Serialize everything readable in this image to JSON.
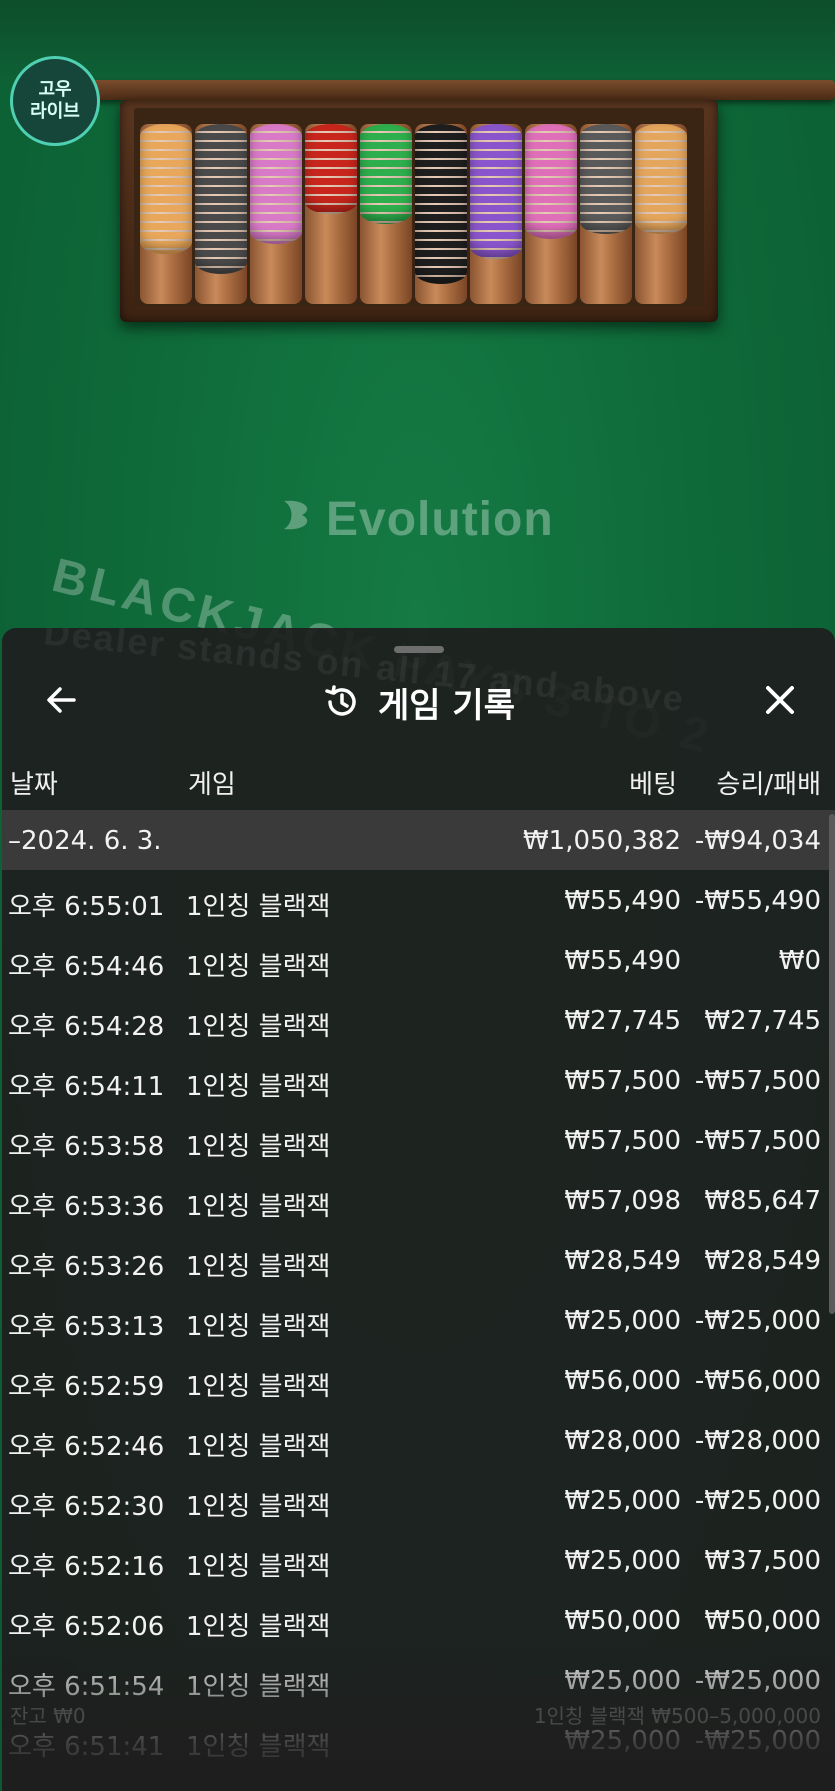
{
  "brand_logo": {
    "line1": "고우",
    "line2": "라이브"
  },
  "table": {
    "provider": "Evolution",
    "arc_text": "BLACKJACK PAYS 3 TO 2",
    "sub_text": "Dealer stands on all 17 and above",
    "chip_colors": [
      "#e8a75a",
      "#4a4a4a",
      "#d97ac8",
      "#c8261c",
      "#2eae4c",
      "#1e1e1e",
      "#8a55cc",
      "#df6fb9",
      "#5a5a5a",
      "#e4a55c"
    ]
  },
  "sheet": {
    "title": "게임 기록",
    "columns": {
      "date": "날짜",
      "game": "게임",
      "bet": "베팅",
      "result": "승리/패배"
    },
    "date_row": {
      "date": "–2024. 6. 3.",
      "bet": "₩1,050,382",
      "result": "-₩94,034"
    },
    "rows": [
      {
        "time": "오후 6:55:01",
        "game": "1인칭 블랙잭",
        "bet": "₩55,490",
        "result": "-₩55,490"
      },
      {
        "time": "오후 6:54:46",
        "game": "1인칭 블랙잭",
        "bet": "₩55,490",
        "result": "₩0"
      },
      {
        "time": "오후 6:54:28",
        "game": "1인칭 블랙잭",
        "bet": "₩27,745",
        "result": "₩27,745"
      },
      {
        "time": "오후 6:54:11",
        "game": "1인칭 블랙잭",
        "bet": "₩57,500",
        "result": "-₩57,500"
      },
      {
        "time": "오후 6:53:58",
        "game": "1인칭 블랙잭",
        "bet": "₩57,500",
        "result": "-₩57,500"
      },
      {
        "time": "오후 6:53:36",
        "game": "1인칭 블랙잭",
        "bet": "₩57,098",
        "result": "₩85,647"
      },
      {
        "time": "오후 6:53:26",
        "game": "1인칭 블랙잭",
        "bet": "₩28,549",
        "result": "₩28,549"
      },
      {
        "time": "오후 6:53:13",
        "game": "1인칭 블랙잭",
        "bet": "₩25,000",
        "result": "-₩25,000"
      },
      {
        "time": "오후 6:52:59",
        "game": "1인칭 블랙잭",
        "bet": "₩56,000",
        "result": "-₩56,000"
      },
      {
        "time": "오후 6:52:46",
        "game": "1인칭 블랙잭",
        "bet": "₩28,000",
        "result": "-₩28,000"
      },
      {
        "time": "오후 6:52:30",
        "game": "1인칭 블랙잭",
        "bet": "₩25,000",
        "result": "-₩25,000"
      },
      {
        "time": "오후 6:52:16",
        "game": "1인칭 블랙잭",
        "bet": "₩25,000",
        "result": "₩37,500"
      },
      {
        "time": "오후 6:52:06",
        "game": "1인칭 블랙잭",
        "bet": "₩50,000",
        "result": "₩50,000"
      },
      {
        "time": "오후 6:51:54",
        "game": "1인칭 블랙잭",
        "bet": "₩25,000",
        "result": "-₩25,000"
      },
      {
        "time": "오후 6:51:41",
        "game": "1인칭 블랙잭",
        "bet": "₩25,000",
        "result": "-₩25,000"
      }
    ],
    "footer_balance": "잔고 ₩0",
    "footer_limits": "1인칭 블랙잭 ₩500–5,000,000"
  }
}
